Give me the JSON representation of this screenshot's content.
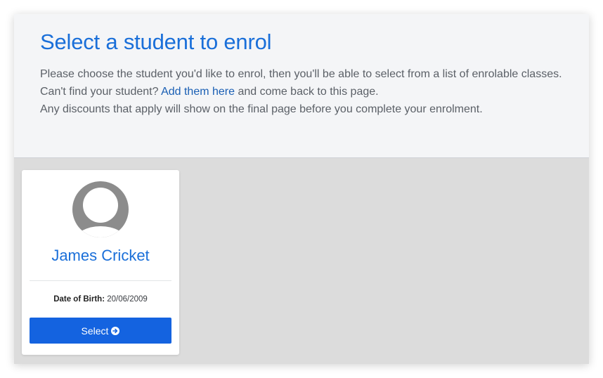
{
  "header": {
    "title": "Select a student to enrol",
    "line1": "Please choose the student you'd like to enrol, then you'll be able to select from a list of enrolable classes.",
    "line2_prefix": "Can't find your student? ",
    "line2_link": "Add them here",
    "line2_suffix": " and come back to this page.",
    "line3": "Any discounts that apply will show on the final page before you complete your enrolment."
  },
  "students": [
    {
      "avatar": "default-user-avatar-icon",
      "name": "James Cricket",
      "dob_label": "Date of Birth:",
      "dob_value": "20/06/2009",
      "button_label": "Select",
      "button_icon": "arrow-circle-right-icon"
    }
  ],
  "colors": {
    "accent": "#1a6fd9",
    "button": "#1463e0",
    "header_bg": "#f4f5f7",
    "panel_bg": "#dcdcdc",
    "link": "#1a5fb4"
  }
}
